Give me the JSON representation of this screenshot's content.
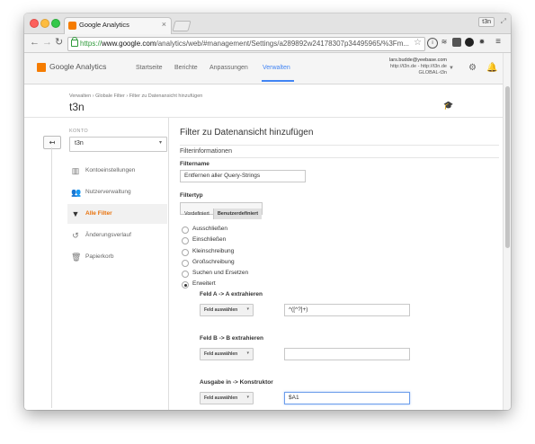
{
  "browser": {
    "tab_title": "Google Analytics",
    "tab_close": "×",
    "profile_label": "t3n",
    "url_secure": "https://",
    "url_host": "www.google.com",
    "url_rest": "/analytics/web/#management/Settings/a289892w24178307p34495965/%3Fm...",
    "colors": {
      "accent": "#f57c00",
      "secure": "#2e9a3a"
    }
  },
  "ga_header": {
    "logo_text": "Google Analytics",
    "nav": [
      "Startseite",
      "Berichte",
      "Anpassungen",
      "Verwalten"
    ],
    "active_nav": "Verwalten",
    "account_email": "lars.budde@yeebase.com",
    "account_property": "http://t3n.de - http://t3n.de",
    "account_view": "GLOBAL-t3n"
  },
  "breadcrumb": {
    "items": [
      "Verwalten",
      "Globale Filter",
      "Filter zu Datenansicht hinzufügen"
    ],
    "separator": "›",
    "title": "t3n"
  },
  "sidebar": {
    "back_glyph": "↤",
    "konto_label": "KONTO",
    "konto_value": "t3n",
    "items": [
      {
        "label": "Kontoeinstellungen",
        "icon": "building-icon"
      },
      {
        "label": "Nutzerverwaltung",
        "icon": "users-icon"
      },
      {
        "label": "Alle Filter",
        "icon": "filter-icon",
        "active": true
      },
      {
        "label": "Änderungsverlauf",
        "icon": "history-icon"
      },
      {
        "label": "Papierkorb",
        "icon": "trash-icon"
      }
    ]
  },
  "form": {
    "heading": "Filter zu Datenansicht hinzufügen",
    "section": "Filterinformationen",
    "filtername_label": "Filtername",
    "filtername_value": "Entfernen aller Query-Strings",
    "filtertyp_label": "Filtertyp",
    "filtertyp_tabs": [
      "Vordefiniert",
      "Benutzerdefiniert"
    ],
    "filtertyp_selected": "Benutzerdefiniert",
    "radio_options": [
      "Ausschließen",
      "Einschließen",
      "Kleinschreibung",
      "Großschreibung",
      "Suchen und Ersetzen",
      "Erweitert"
    ],
    "radio_selected": "Erweitert",
    "field_a_label": "Feld A -> A extrahieren",
    "field_a_button": "Feld auswählen",
    "field_a_value": "^([^?]+)",
    "field_b_label": "Feld B -> B extrahieren",
    "field_b_button": "Feld auswählen",
    "field_b_value": "",
    "output_label": "Ausgabe in -> Konstruktor",
    "output_button": "Feld auswählen",
    "output_value": "$A1"
  }
}
